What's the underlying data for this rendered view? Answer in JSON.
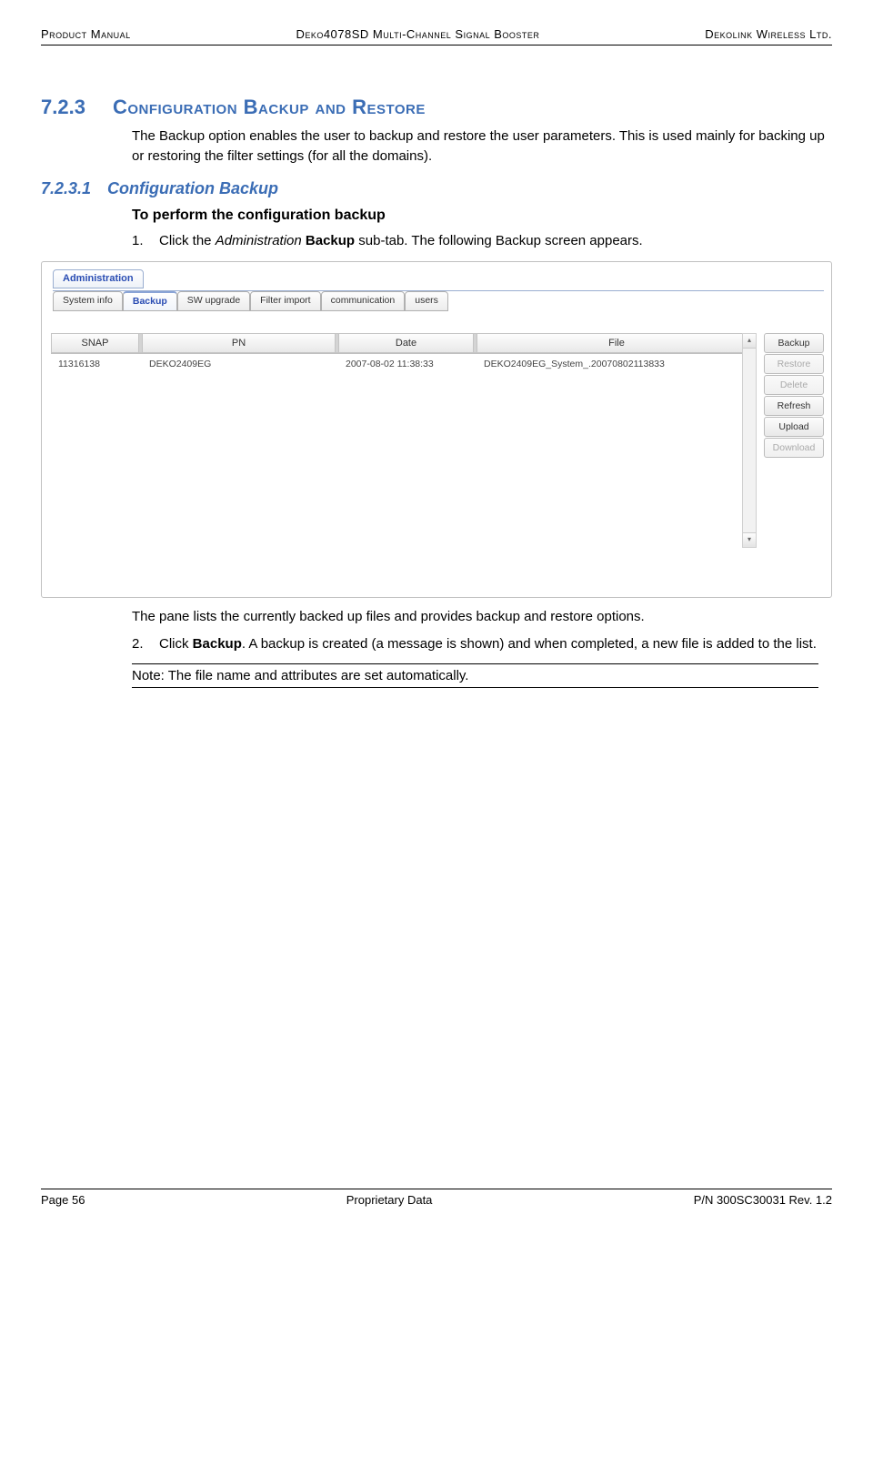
{
  "header": {
    "left": "Product Manual",
    "center": "Deko4078SD Multi-Channel Signal Booster",
    "right": "Dekolink Wireless Ltd."
  },
  "section": {
    "number": "7.2.3",
    "title": "Configuration Backup and Restore",
    "intro": "The Backup option enables the user to backup and restore the user parameters. This is used mainly for backing up or restoring the filter settings (for all the domains)."
  },
  "subsection": {
    "number": "7.2.3.1",
    "title": "Configuration Backup"
  },
  "procedure_heading": "To perform the configuration backup",
  "steps": {
    "one_num": "1.",
    "one_prefix": "Click the ",
    "one_italic": "Administration ",
    "one_bold": "Backup",
    "one_suffix": " sub-tab. The following Backup screen appears.",
    "two_num": "2.",
    "two_prefix": "Click ",
    "two_bold": "Backup",
    "two_suffix": ". A backup is created (a message is shown) and when completed, a new file is added to the list."
  },
  "after_image_text": "The pane lists the currently backed up files and provides backup and restore options.",
  "note": "Note: The file name and attributes are set automatically.",
  "screenshot": {
    "main_tab": "Administration",
    "subtabs": [
      "System info",
      "Backup",
      "SW upgrade",
      "Filter import",
      "communication",
      "users"
    ],
    "active_subtab_index": 1,
    "columns": [
      "SNAP",
      "PN",
      "Date",
      "File"
    ],
    "row": {
      "snap": "11316138",
      "pn": "DEKO2409EG",
      "date": "2007-08-02 11:38:33",
      "file": "DEKO2409EG_System_.20070802113833"
    },
    "buttons": [
      "Backup",
      "Restore",
      "Delete",
      "Refresh",
      "Upload",
      "Download"
    ]
  },
  "footer": {
    "left": "Page 56",
    "center": "Proprietary Data",
    "right": "P/N 300SC30031 Rev. 1.2"
  }
}
